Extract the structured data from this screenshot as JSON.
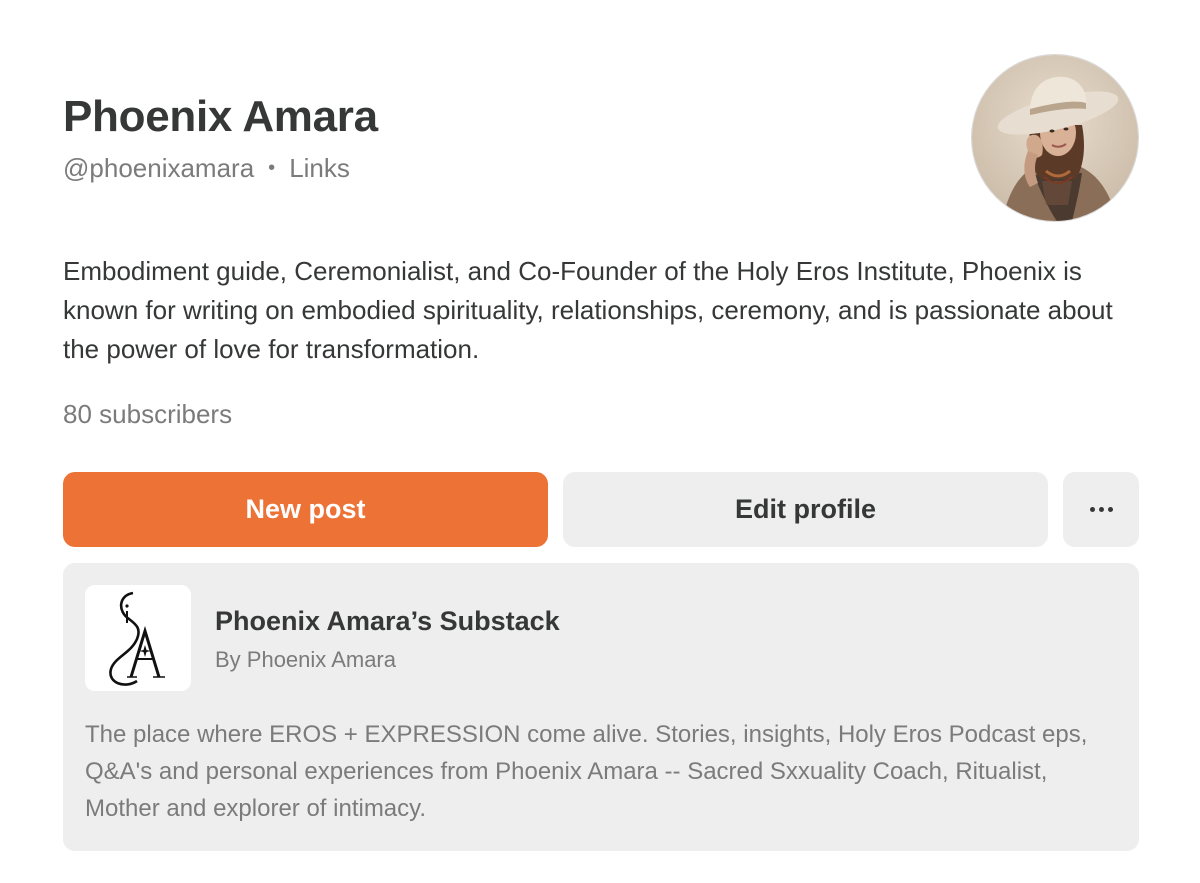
{
  "profile": {
    "name": "Phoenix Amara",
    "handle": "@phoenixamara",
    "separator": "•",
    "links_label": "Links",
    "bio": "Embodiment guide, Ceremonialist, and Co-Founder of the Holy Eros Institute, Phoenix is known for writing on embodied spirituality, relationships, ceremony, and is passionate about the power of love for transformation.",
    "subscribers": "80 subscribers"
  },
  "actions": {
    "new_post_label": "New post",
    "edit_profile_label": "Edit profile",
    "more_icon": "more-horizontal-icon"
  },
  "publication": {
    "title": "Phoenix Amara’s Substack",
    "byline": "By Phoenix Amara",
    "description": "The place where EROS + EXPRESSION come alive. Stories, insights, Holy Eros Podcast eps, Q&A's and personal experiences from Phoenix Amara -- Sacred Sxxuality Coach, Ritualist, Mother and explorer of intimacy."
  },
  "colors": {
    "accent": "#ec7236",
    "text": "#363737",
    "muted": "#7b7b7b",
    "surface": "#eeeeee"
  }
}
